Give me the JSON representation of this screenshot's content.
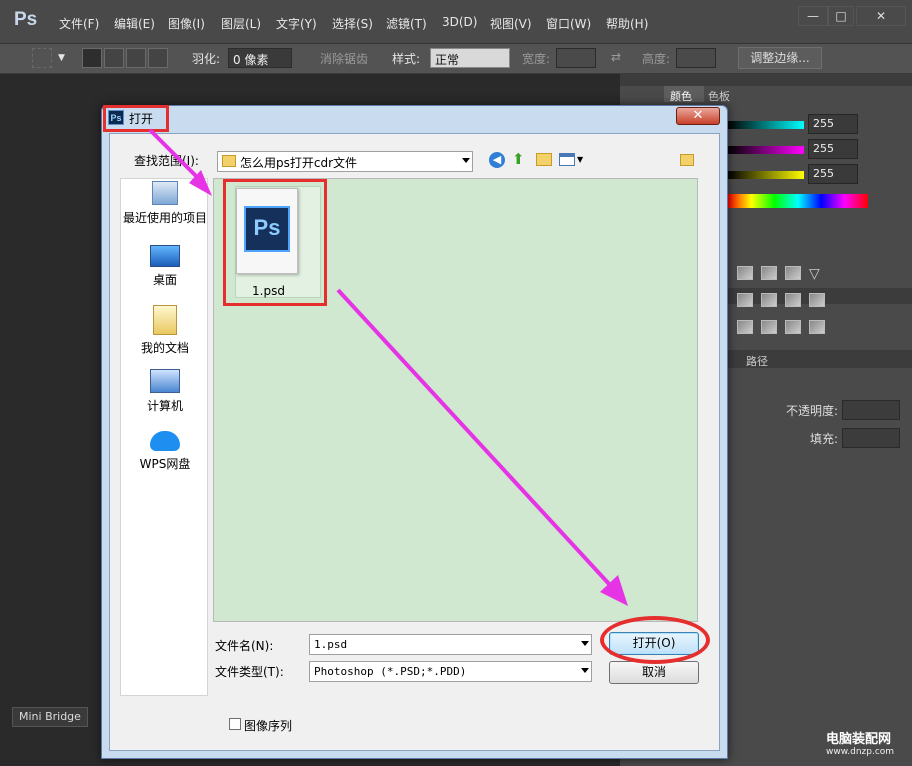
{
  "app": {
    "logo": "Ps"
  },
  "menubar": {
    "items": [
      "文件(F)",
      "编辑(E)",
      "图像(I)",
      "图层(L)",
      "文字(Y)",
      "选择(S)",
      "滤镜(T)",
      "3D(D)",
      "视图(V)",
      "窗口(W)",
      "帮助(H)"
    ],
    "window_buttons": [
      "—",
      "□",
      "✕"
    ]
  },
  "options_bar": {
    "feather_label": "羽化:",
    "feather_value": "0 像素",
    "antialias_label": "消除锯齿",
    "style_label": "样式:",
    "style_value": "正常",
    "width_label": "宽度:",
    "height_label": "高度:",
    "refine_edge": "调整边缘..."
  },
  "right_panel": {
    "tabs": [
      "颜色",
      "色板"
    ],
    "values": [
      "255",
      "255",
      "255"
    ],
    "paths_tab": "路径",
    "opacity_label": "不透明度:",
    "fill_label": "填充:"
  },
  "mini_bridge": "Mini Bridge",
  "watermark": {
    "name": "电脑装配网",
    "url": "www.dnzp.com"
  },
  "dialog": {
    "title": "打开",
    "ps_icon": "Ps",
    "look_in_label": "查找范围(I):",
    "look_in_value": "怎么用ps打开cdr文件",
    "places": [
      "最近使用的项目",
      "桌面",
      "我的文档",
      "计算机",
      "WPS网盘"
    ],
    "file": {
      "name": "1.psd",
      "icon_text": "Ps"
    },
    "filename_label": "文件名(N):",
    "filename_value": "1.psd",
    "filetype_label": "文件类型(T):",
    "filetype_value": "Photoshop (*.PSD;*.PDD)",
    "open_button": "打开(O)",
    "cancel_button": "取消",
    "image_sequence": "图像序列"
  },
  "colors": {
    "annotation": "#e52e2e",
    "arrow": "#e633e6",
    "file_area": "#cfe8cf"
  }
}
